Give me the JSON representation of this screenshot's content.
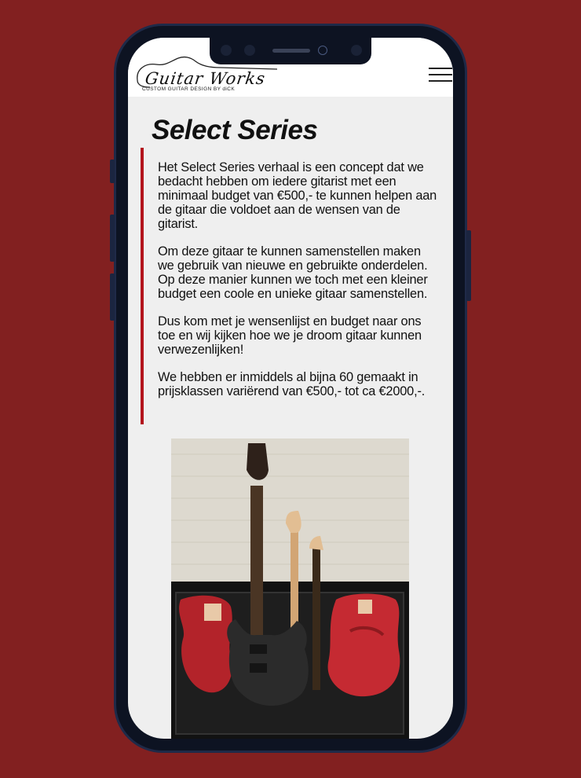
{
  "header": {
    "logo_text": "Guitar Works",
    "logo_tagline": "CUSTOM GUITAR DESIGN BY diCK",
    "menu_icon": "hamburger-menu-icon"
  },
  "page": {
    "title": "Select Series",
    "accent_color": "#b3141c",
    "background_color": "#822020",
    "paragraphs": [
      "Het Select Series verhaal is een concept dat we bedacht hebben om iedere gitarist met een minimaal budget van €500,- te kunnen helpen aan de gitaar die voldoet aan de wensen van de gitarist.",
      "Om deze gitaar te kunnen samenstellen maken we gebruik van nieuwe en gebruikte onderdelen. Op deze manier kunnen we toch met een kleiner budget een coole en unieke gitaar samenstellen.",
      "Dus kom met je wensenlijst en budget naar ons toe en wij kijken hoe we je droom gitaar kunnen verwezenlijken!",
      "We hebben er inmiddels al bijna 60 gemaakt in prijsklassen variërend van €500,- tot ca €2000,-."
    ]
  }
}
